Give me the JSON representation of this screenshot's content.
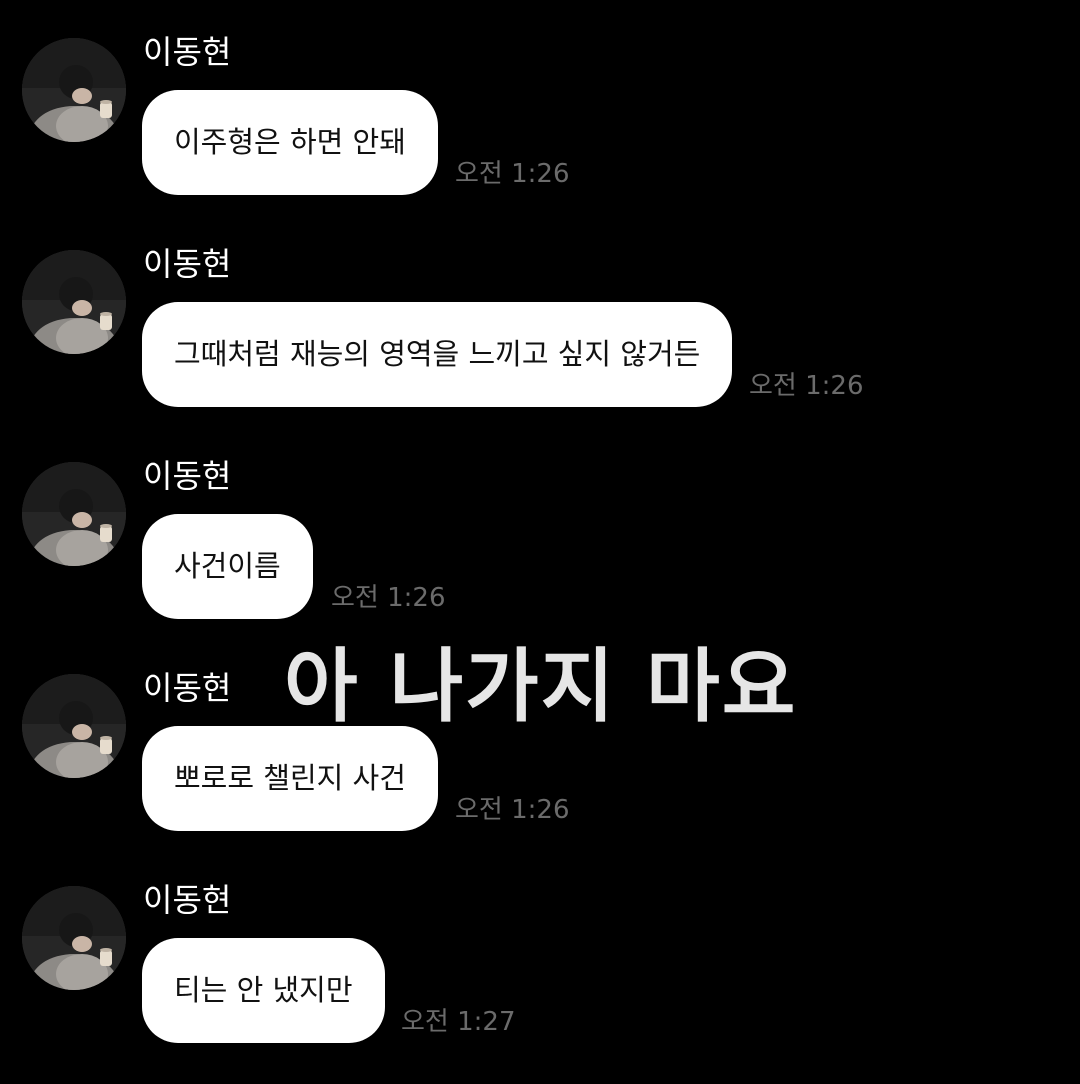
{
  "messages": [
    {
      "sender": "이동현",
      "text": "이주형은 하면 안돼",
      "time": "오전 1:26"
    },
    {
      "sender": "이동현",
      "text": "그때처럼 재능의 영역을 느끼고 싶지 않거든",
      "time": "오전 1:26"
    },
    {
      "sender": "이동현",
      "text": "사건이름",
      "time": "오전 1:26"
    },
    {
      "sender": "이동현",
      "text": "뽀로로 챌린지 사건",
      "time": "오전 1:26"
    },
    {
      "sender": "이동현",
      "text": "티는 안 냈지만",
      "time": "오전 1:27"
    }
  ],
  "overlay_caption": "아 나가지 마요",
  "colors": {
    "background": "#000000",
    "bubble": "#ffffff",
    "bubble_text": "#111111",
    "sender_text": "#ffffff",
    "time_text": "#6b6b6b",
    "overlay_text": "#e6e6e6"
  },
  "icons": {
    "avatar": "profile-photo"
  }
}
